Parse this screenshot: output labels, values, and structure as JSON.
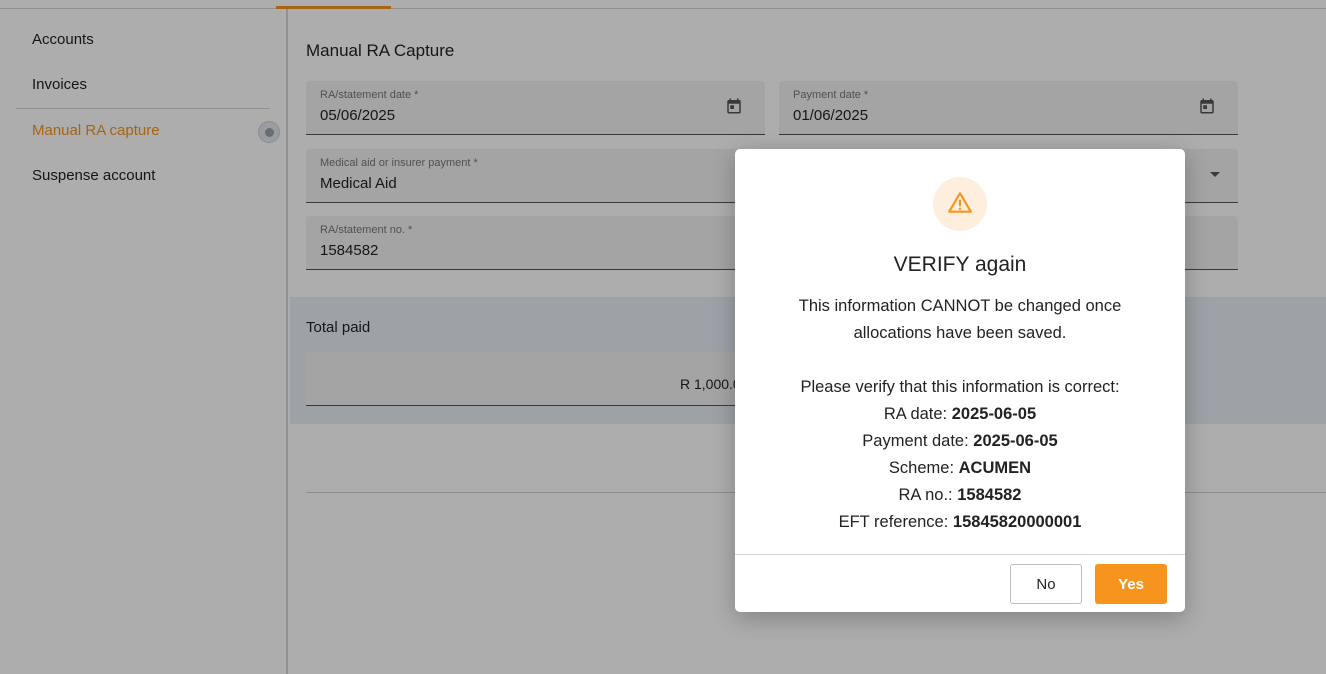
{
  "sidebar": {
    "items": [
      {
        "label": "Accounts"
      },
      {
        "label": "Invoices"
      },
      {
        "label": "Manual RA capture"
      },
      {
        "label": "Suspense account"
      }
    ]
  },
  "page": {
    "title": "Manual RA Capture",
    "ra_date": {
      "label": "RA/statement date *",
      "value": "05/06/2025"
    },
    "payment_date": {
      "label": "Payment date *",
      "value": "01/06/2025"
    },
    "payer": {
      "label": "Medical aid or insurer payment *",
      "value": "Medical Aid"
    },
    "ra_no": {
      "label": "RA/statement no. *",
      "value": "1584582"
    },
    "total_paid_label": "Total paid",
    "total_paid_value": "R 1,000.0"
  },
  "dialog": {
    "title": "VERIFY again",
    "line1": "This information CANNOT be changed once",
    "line2": "allocations have been saved.",
    "line3": "Please verify that this information is correct:",
    "ra_date_label": "RA date:",
    "ra_date_value": "2025-06-05",
    "payment_date_label": "Payment date:",
    "payment_date_value": "2025-06-05",
    "scheme_label": "Scheme:",
    "scheme_value": "ACUMEN",
    "ra_no_label": "RA no.:",
    "ra_no_value": "1584582",
    "eft_label": "EFT reference:",
    "eft_value": "15845820000001",
    "no_label": "No",
    "yes_label": "Yes"
  },
  "colors": {
    "accent": "#f7941d",
    "warning_bg": "#fdeede",
    "band_bg": "#e8eff7"
  },
  "icons": {
    "calendar": "calendar-icon",
    "warning": "warning-triangle-icon",
    "dropdown": "chevron-down-icon"
  }
}
